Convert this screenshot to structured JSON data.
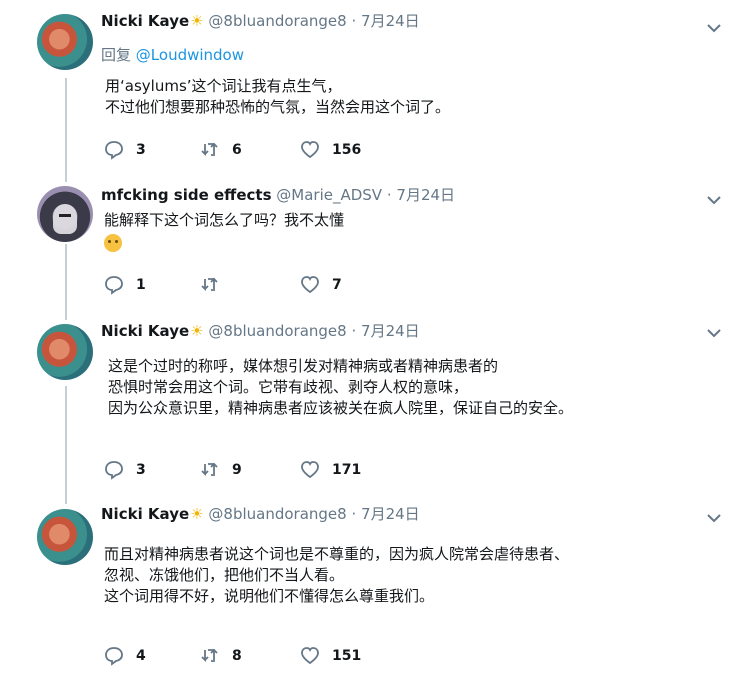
{
  "tweets": [
    {
      "name": "Nicki Kaye",
      "sun": "☀",
      "handle": "@8bluandorange8",
      "dot": "·",
      "date": "7月24日",
      "reply_prefix": "回复",
      "reply_mention": "@Loudwindow",
      "lines": [
        "用‘asylums’这个词让我有点生气，",
        "不过他们想要那种恐怖的气氛，当然会用这个词了。"
      ],
      "replies": "3",
      "retweets": "6",
      "likes": "156"
    },
    {
      "name": "mfcking side effects",
      "handle": "@Marie_ADSV",
      "dot": "·",
      "date": "7月24日",
      "lines": [
        "能解释下这个词怎么了吗？我不太懂"
      ],
      "emoji": "thinking-face-icon",
      "replies": "1",
      "retweets": "",
      "likes": "7"
    },
    {
      "name": "Nicki Kaye",
      "sun": "☀",
      "handle": "@8bluandorange8",
      "dot": "·",
      "date": "7月24日",
      "lines": [
        "这是个过时的称呼，媒体想引发对精神病或者精神病患者的",
        "恐惧时常会用这个词。它带有歧视、剥夺人权的意味，",
        "因为公众意识里，精神病患者应该被关在疯人院里，保证自己的安全。"
      ],
      "replies": "3",
      "retweets": "9",
      "likes": "171"
    },
    {
      "name": "Nicki Kaye",
      "sun": "☀",
      "handle": "@8bluandorange8",
      "dot": "·",
      "date": "7月24日",
      "lines": [
        "而且对精神病患者说这个词也是不尊重的，因为疯人院常会虐待患者、",
        "忽视、冻饿他们，把他们不当人看。",
        "这个词用得不好，说明他们不懂得怎么尊重我们。"
      ],
      "replies": "4",
      "retweets": "8",
      "likes": "151"
    }
  ],
  "colors": {
    "text": "#14171a",
    "secondary": "#657786",
    "link": "#1b95e0",
    "thread_line": "#c4cfd6"
  }
}
